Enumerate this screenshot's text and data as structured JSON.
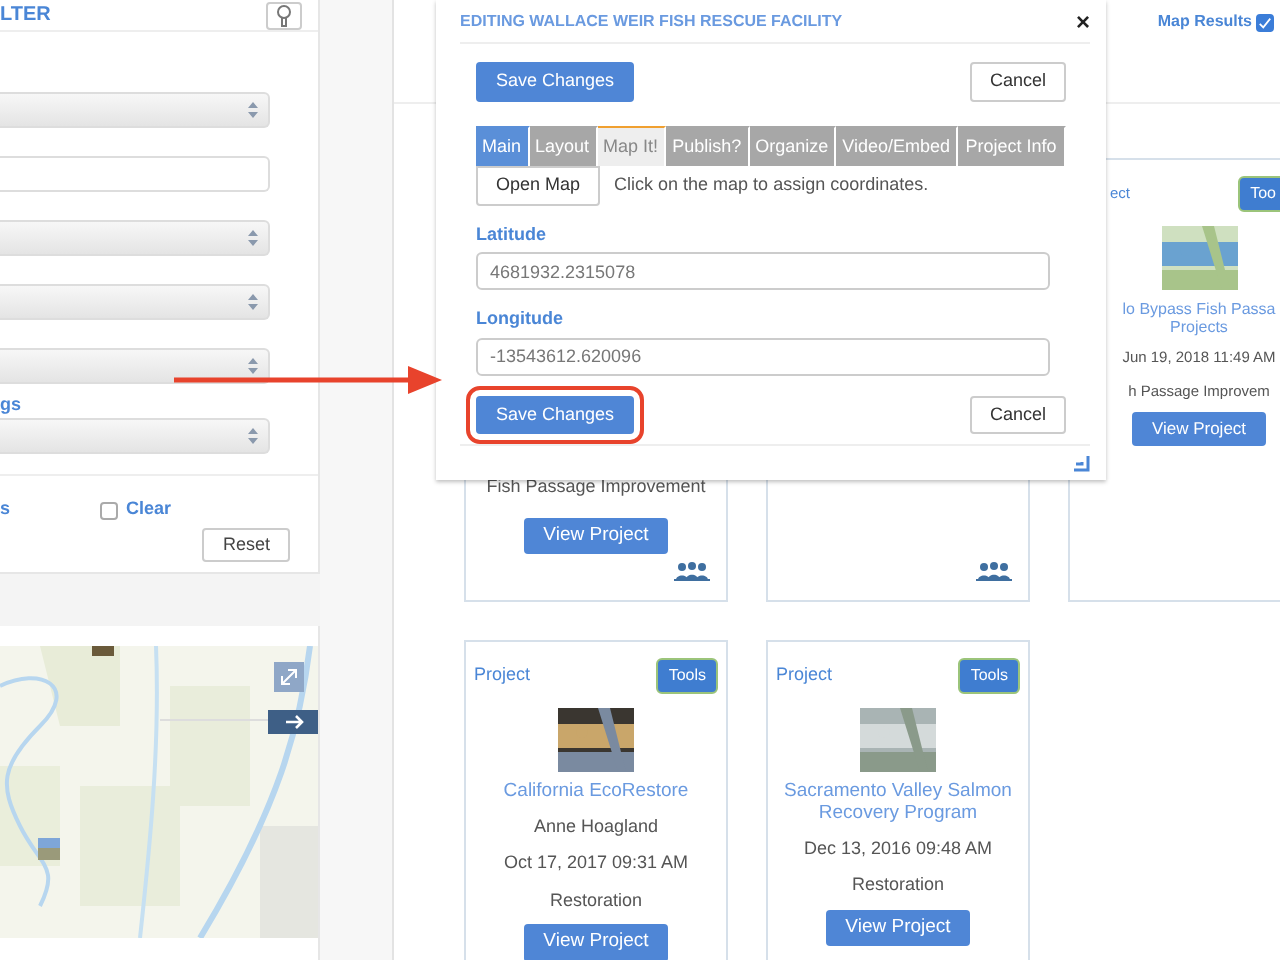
{
  "filter_panel": {
    "title": "LTER",
    "fields": [
      {
        "kind": "select"
      },
      {
        "kind": "text"
      },
      {
        "kind": "select"
      },
      {
        "kind": "select"
      },
      {
        "kind": "select"
      },
      {
        "kind": "select",
        "label": "gs"
      }
    ],
    "option_label": "s",
    "clear": {
      "label": "Clear",
      "checked": false
    },
    "reset_button": "Reset"
  },
  "map_panel": {
    "kind": "picture"
  },
  "toolbar": {
    "map_results": {
      "label": "Map Results",
      "checked": true
    }
  },
  "cards": [
    {
      "category": "Fish Passage Improvement",
      "button": "View Project",
      "team_icon": true
    },
    {
      "team_icon": true
    },
    {
      "label": "ect",
      "tools": "Too",
      "picture": {
        "kind": "picture"
      },
      "title": [
        "lo Bypass Fish Passa",
        "Projects"
      ],
      "date": "Jun 19, 2018 11:49 AM",
      "category": "h Passage Improvem",
      "button": "View Project"
    },
    {
      "label": "Project",
      "tools": "Tools",
      "picture": {
        "kind": "picture"
      },
      "title": [
        "California EcoRestore"
      ],
      "author": "Anne Hoagland",
      "date": "Oct 17, 2017 09:31 AM",
      "category": "Restoration",
      "button": "View Project"
    },
    {
      "label": "Project",
      "tools": "Tools",
      "picture": {
        "kind": "picture"
      },
      "title": [
        "Sacramento Valley Salmon",
        "Recovery Program"
      ],
      "date": "Dec 13, 2016 09:48 AM",
      "category": "Restoration",
      "button": "View Project"
    }
  ],
  "dialog": {
    "title": "EDITING WALLACE WEIR FISH RESCUE FACILITY",
    "close": "×",
    "save_button": "Save Changes",
    "cancel_button": "Cancel",
    "tabs": [
      {
        "label": "Main",
        "selected": false,
        "highlighted": true
      },
      {
        "label": "Layout",
        "selected": false,
        "highlighted": false
      },
      {
        "label": "Map It!",
        "selected": true,
        "highlighted": false
      },
      {
        "label": "Publish?",
        "selected": false,
        "highlighted": false
      },
      {
        "label": "Organize",
        "selected": false,
        "highlighted": false
      },
      {
        "label": "Video/Embed",
        "selected": false,
        "highlighted": false
      },
      {
        "label": "Project Info",
        "selected": false,
        "highlighted": false
      }
    ],
    "open_map_button": "Open Map",
    "hint": "Click on the map to assign coordinates.",
    "fields": [
      {
        "label": "Latitude",
        "value": "4681932.2315078"
      },
      {
        "label": "Longitude",
        "value": "-13543612.620096"
      }
    ],
    "footer_save_button": "Save Changes",
    "footer_cancel_button": "Cancel",
    "footer_highlighted": true
  }
}
